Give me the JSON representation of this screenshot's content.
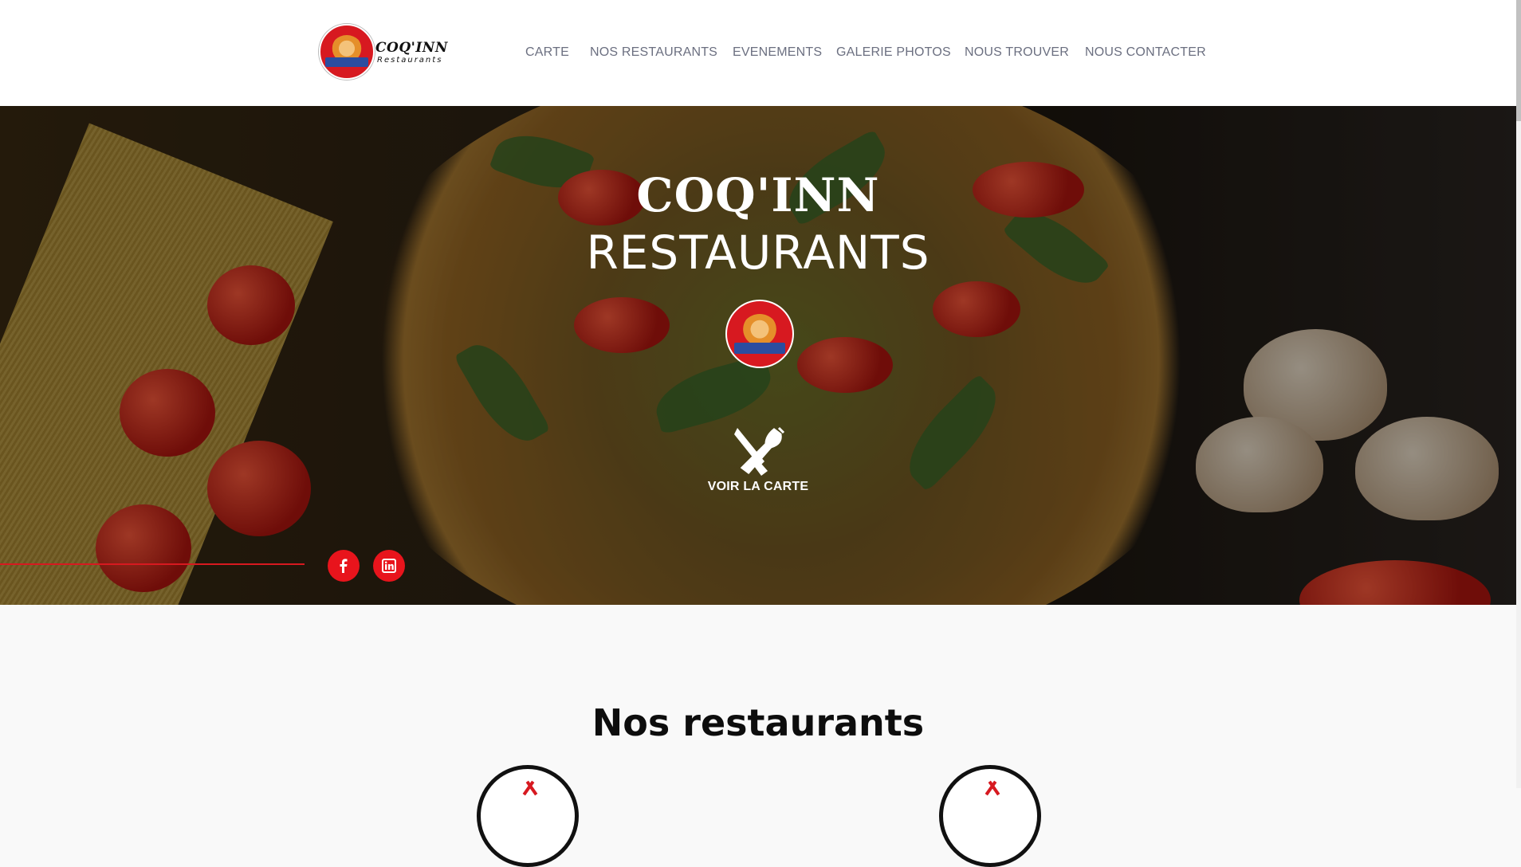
{
  "brand": {
    "logo_line1": "COQ'INN",
    "logo_line2": "Restaurants"
  },
  "nav": {
    "items": [
      {
        "label": "CARTE"
      },
      {
        "label": "NOS RESTAURANTS"
      },
      {
        "label": "EVENEMENTS"
      },
      {
        "label": "GALERIE PHOTOS"
      },
      {
        "label": "NOUS TROUVER"
      },
      {
        "label": "NOUS CONTACTER"
      }
    ]
  },
  "hero": {
    "title_line1": "COQ'INN",
    "title_line2": "RESTAURANTS",
    "cta_label": "VOIR LA CARTE",
    "cta_icon": "fork-knife-icon",
    "social": [
      {
        "icon": "facebook-icon"
      },
      {
        "icon": "linkedin-icon"
      }
    ]
  },
  "section": {
    "title": "Nos restaurants"
  },
  "colors": {
    "accent": "#d71920",
    "nav_text": "#6b6f80",
    "hero_text": "#ffffff",
    "badge_blue": "#2b4da0"
  }
}
